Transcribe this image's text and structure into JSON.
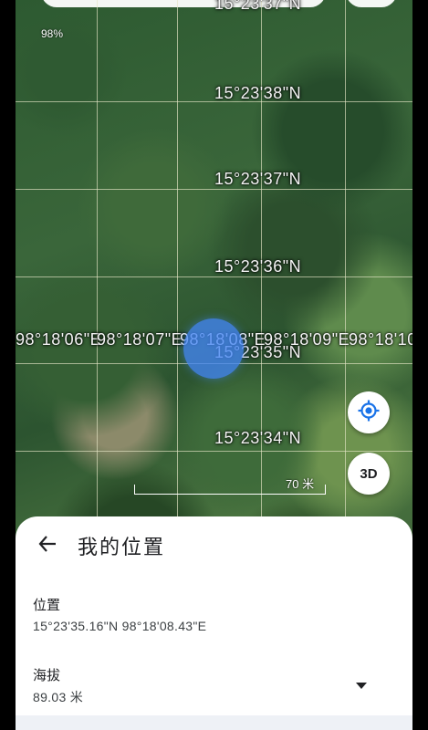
{
  "map": {
    "zoom_percent": "98%",
    "lat_labels": [
      "15°23'37\"N",
      "15°23'38\"N",
      "15°23'37\"N",
      "15°23'36\"N",
      "15°23'35\"N",
      "15°23'34\"N"
    ],
    "lon_labels": [
      "98°18'06\"E",
      "98°18'07\"E",
      "98°18'08\"E",
      "98°18'09\"E",
      "98°18'10"
    ],
    "scale_label": "70 米",
    "threed_label": "3D",
    "icons": [
      "my-location-icon"
    ]
  },
  "sheet": {
    "title": "我的位置",
    "back_icon": "arrow-left-icon",
    "location_label": "位置",
    "location_value": "15°23'35.16\"N 98°18'08.43\"E",
    "altitude_label": "海拔",
    "altitude_value": "89.03 米",
    "dropdown_icon": "caret-down-icon"
  },
  "colors": {
    "location_dot": "#4285F4",
    "sheet_bg": "#FFFFFF",
    "grid_line": "#E6E6C8"
  }
}
